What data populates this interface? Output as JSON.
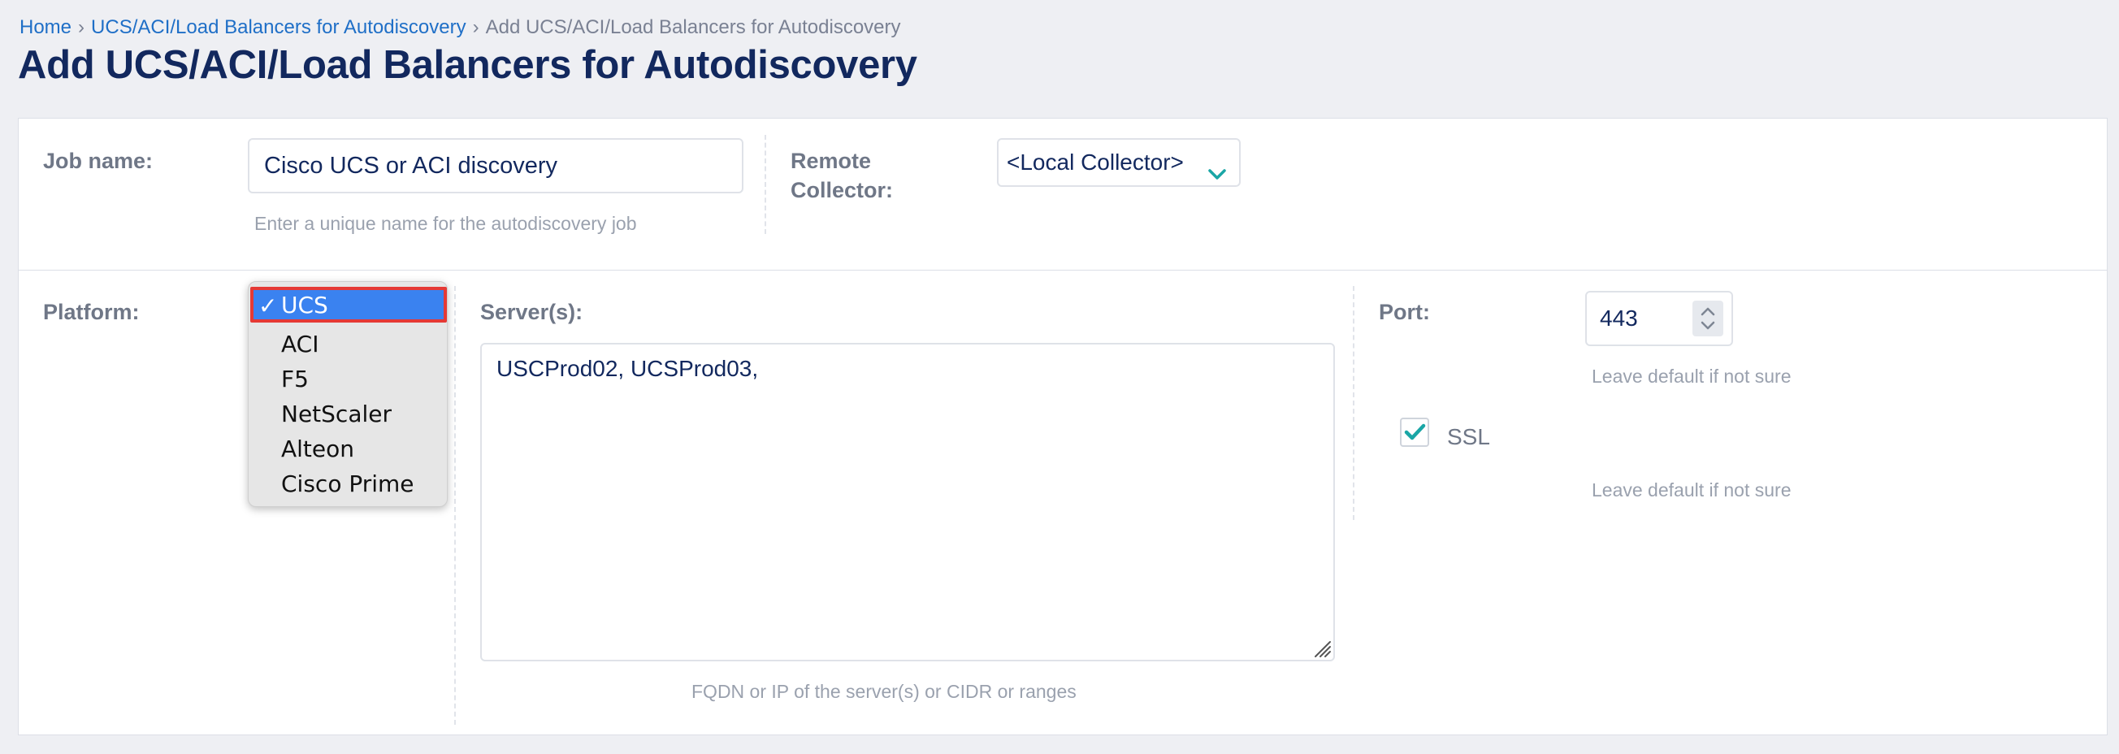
{
  "breadcrumb": {
    "home": "Home",
    "sep1": "›",
    "section": "UCS/ACI/Load Balancers for Autodiscovery",
    "sep2": "›",
    "current": "Add UCS/ACI/Load Balancers for Autodiscovery"
  },
  "page_title": "Add UCS/ACI/Load Balancers for Autodiscovery",
  "job": {
    "label": "Job name:",
    "value": "Cisco UCS or ACI discovery",
    "help": "Enter a unique name for the autodiscovery job"
  },
  "collector": {
    "label_line1": "Remote",
    "label_line2": "Collector:",
    "value": "<Local Collector>"
  },
  "platform": {
    "label": "Platform:",
    "options": [
      "UCS",
      "ACI",
      "F5",
      "NetScaler",
      "Alteon",
      "Cisco Prime"
    ],
    "selected": "UCS",
    "check_glyph": "✓"
  },
  "servers": {
    "label": "Server(s):",
    "value": "USCProd02, UCSProd03,",
    "help": "FQDN or IP of the server(s) or CIDR or ranges"
  },
  "port": {
    "label": "Port:",
    "value": "443",
    "help": "Leave default if not sure"
  },
  "ssl": {
    "label": "SSL",
    "checked": true,
    "help": "Leave default if not sure"
  },
  "colors": {
    "accent_teal": "#1aa6a6",
    "link_blue": "#1f6fc7",
    "title_navy": "#12285e",
    "selection_blue": "#3a82f0",
    "highlight_red": "#e53935"
  },
  "icons": {
    "collector_dropdown": "chevron-down-icon",
    "port_spinner": "up-down-arrows-icon",
    "ssl_checkbox": "checkmark-icon",
    "textarea_resize": "resize-grip-icon"
  }
}
